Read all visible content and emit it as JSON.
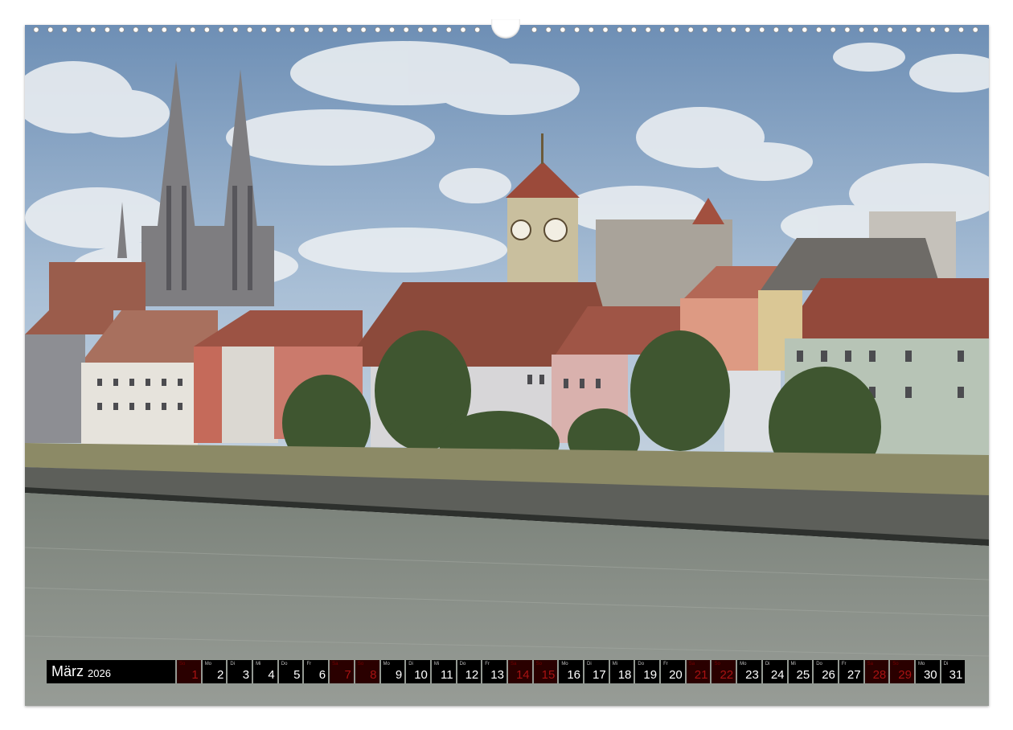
{
  "calendar": {
    "month": "März",
    "year": "2026",
    "days": [
      {
        "weekday": "So",
        "day": "1",
        "weekend": true
      },
      {
        "weekday": "Mo",
        "day": "2",
        "weekend": false
      },
      {
        "weekday": "Di",
        "day": "3",
        "weekend": false
      },
      {
        "weekday": "Mi",
        "day": "4",
        "weekend": false
      },
      {
        "weekday": "Do",
        "day": "5",
        "weekend": false
      },
      {
        "weekday": "Fr",
        "day": "6",
        "weekend": false
      },
      {
        "weekday": "Sa",
        "day": "7",
        "weekend": true
      },
      {
        "weekday": "So",
        "day": "8",
        "weekend": true
      },
      {
        "weekday": "Mo",
        "day": "9",
        "weekend": false
      },
      {
        "weekday": "Di",
        "day": "10",
        "weekend": false
      },
      {
        "weekday": "Mi",
        "day": "11",
        "weekend": false
      },
      {
        "weekday": "Do",
        "day": "12",
        "weekend": false
      },
      {
        "weekday": "Fr",
        "day": "13",
        "weekend": false
      },
      {
        "weekday": "Sa",
        "day": "14",
        "weekend": true
      },
      {
        "weekday": "So",
        "day": "15",
        "weekend": true
      },
      {
        "weekday": "Mo",
        "day": "16",
        "weekend": false
      },
      {
        "weekday": "Di",
        "day": "17",
        "weekend": false
      },
      {
        "weekday": "Mi",
        "day": "18",
        "weekend": false
      },
      {
        "weekday": "Do",
        "day": "19",
        "weekend": false
      },
      {
        "weekday": "Fr",
        "day": "20",
        "weekend": false
      },
      {
        "weekday": "Sa",
        "day": "21",
        "weekend": true
      },
      {
        "weekday": "So",
        "day": "22",
        "weekend": true
      },
      {
        "weekday": "Mo",
        "day": "23",
        "weekend": false
      },
      {
        "weekday": "Di",
        "day": "24",
        "weekend": false
      },
      {
        "weekday": "Mi",
        "day": "25",
        "weekend": false
      },
      {
        "weekday": "Do",
        "day": "26",
        "weekend": false
      },
      {
        "weekday": "Fr",
        "day": "27",
        "weekend": false
      },
      {
        "weekday": "Sa",
        "day": "28",
        "weekend": true
      },
      {
        "weekday": "So",
        "day": "29",
        "weekend": true
      },
      {
        "weekday": "Mo",
        "day": "30",
        "weekend": false
      },
      {
        "weekday": "Di",
        "day": "31",
        "weekend": false
      }
    ]
  },
  "colors": {
    "strip_background": "#000000",
    "weekend_number": "#a81212",
    "weekday_number": "#ffffff"
  }
}
